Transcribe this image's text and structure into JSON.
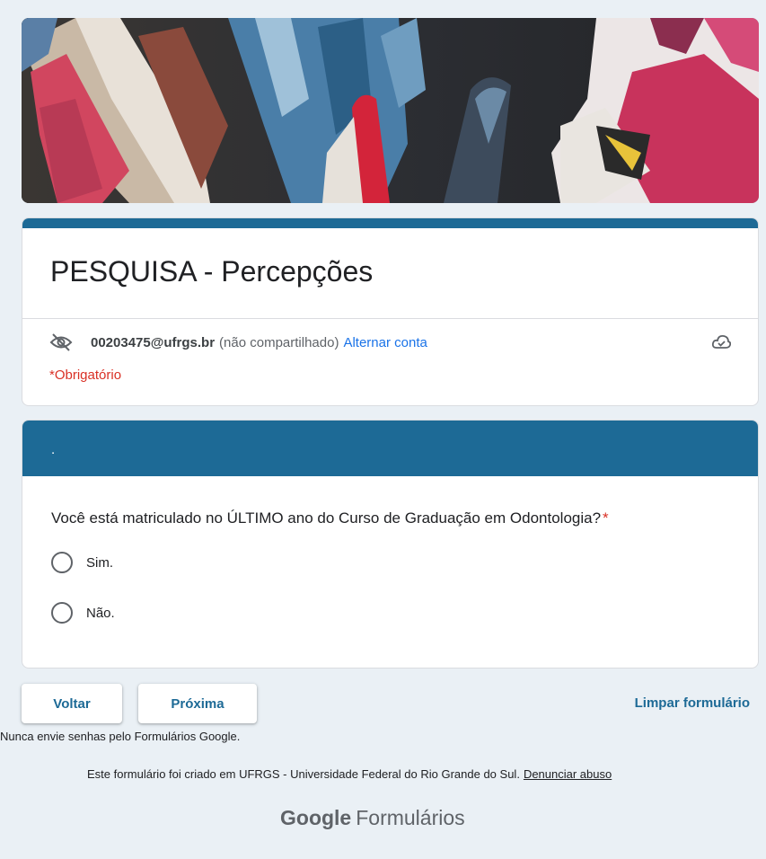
{
  "form": {
    "title": "PESQUISA - Percepções",
    "account_email": "00203475@ufrgs.br",
    "account_shared_text": "(não compartilhado)",
    "switch_account_label": "Alternar conta",
    "required_note": "*Obrigatório"
  },
  "section": {
    "header_text": ".",
    "question": "Você está matriculado no ÚLTIMO ano do Curso de Graduação em Odontologia?",
    "required_marker": "*",
    "options": [
      "Sim.",
      "Não."
    ]
  },
  "nav": {
    "back_label": "Voltar",
    "next_label": "Próxima",
    "clear_label": "Limpar formulário"
  },
  "footer": {
    "password_note": "Nunca envie senhas pelo Formulários Google.",
    "created_text": "Este formulário foi criado em UFRGS - Universidade Federal do Rio Grande do Sul.",
    "report_abuse_label": "Denunciar abuso",
    "brand_google": "Google",
    "brand_product": "Formulários"
  },
  "colors": {
    "accent": "#1d6a96",
    "required": "#d93025",
    "link": "#1a73e8",
    "background": "#eaf0f5"
  },
  "icons": {
    "hidden": "eye-off-icon",
    "cloud": "cloud-check-icon",
    "radio": "radio-unchecked-icon"
  }
}
